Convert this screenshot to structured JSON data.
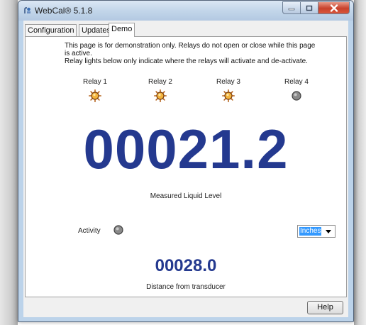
{
  "window": {
    "title": "WebCal® 5.1.8"
  },
  "caption_buttons": {
    "minimize_icon": "minimize-icon",
    "maximize_icon": "maximize-icon",
    "close_icon": "close-icon"
  },
  "tabs": [
    {
      "label": "Configuration",
      "active": false
    },
    {
      "label": "Updates",
      "active": false
    },
    {
      "label": "Demo",
      "active": true
    }
  ],
  "demo": {
    "notice_line1": "This page is for demonstration only.  Relays do not open or close while this page is active.",
    "notice_line2": "Relay lights below only indicate where the relays will activate and de-activate.",
    "relays": [
      {
        "label": "Relay 1",
        "state": "on"
      },
      {
        "label": "Relay 2",
        "state": "on"
      },
      {
        "label": "Relay 3",
        "state": "on"
      },
      {
        "label": "Relay 4",
        "state": "off"
      }
    ],
    "measured_value": "00021.2",
    "measured_label": "Measured Liquid Level",
    "activity_label": "Activity",
    "activity_state": "off",
    "units_selected": "Inches",
    "distance_value": "00028.0",
    "distance_label": "Distance from transducer"
  },
  "footer": {
    "help_label": "Help"
  },
  "colors": {
    "reading_blue": "#24398f",
    "light_on": "#d98a1c",
    "light_off": "#7a7a7a",
    "selection_blue": "#3399ff"
  }
}
